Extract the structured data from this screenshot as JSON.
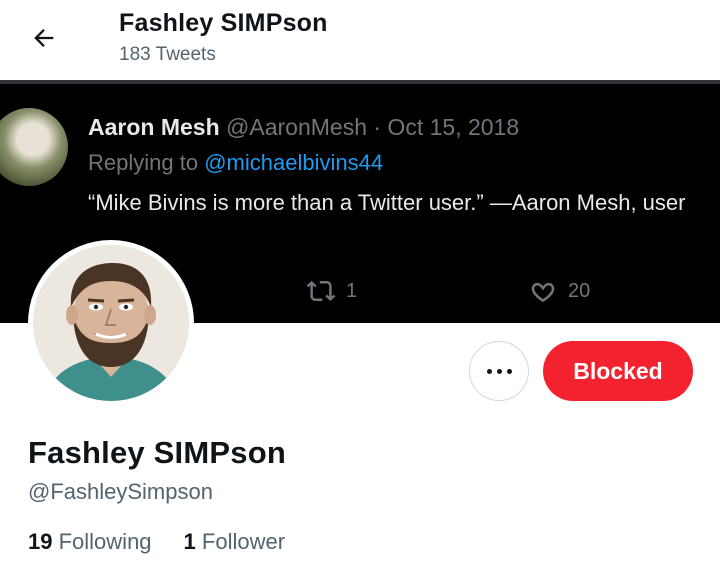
{
  "header": {
    "title": "Fashley SIMPson",
    "tweet_count": "183 Tweets",
    "back_icon": "arrow-left-icon"
  },
  "banner": {
    "author_name": "Aaron Mesh",
    "author_meta": "@AaronMesh · Oct 15, 2018",
    "replying_prefix": "Replying to",
    "replying_to": "@michaelbivins44",
    "text": "“Mike Bivins is more than a Twitter user.” —Aaron Mesh, user",
    "retweets": "1",
    "likes": "20",
    "colors": {
      "background": "#000000",
      "mention": "#1d9bf0"
    }
  },
  "profile": {
    "name": "Fashley SIMPson",
    "handle": "@FashleySimpson",
    "following_count": "19",
    "following_label": "Following",
    "followers_count": "1",
    "followers_label": "Follower",
    "blocked_label": "Blocked",
    "colors": {
      "blocked": "#f4212e"
    }
  }
}
